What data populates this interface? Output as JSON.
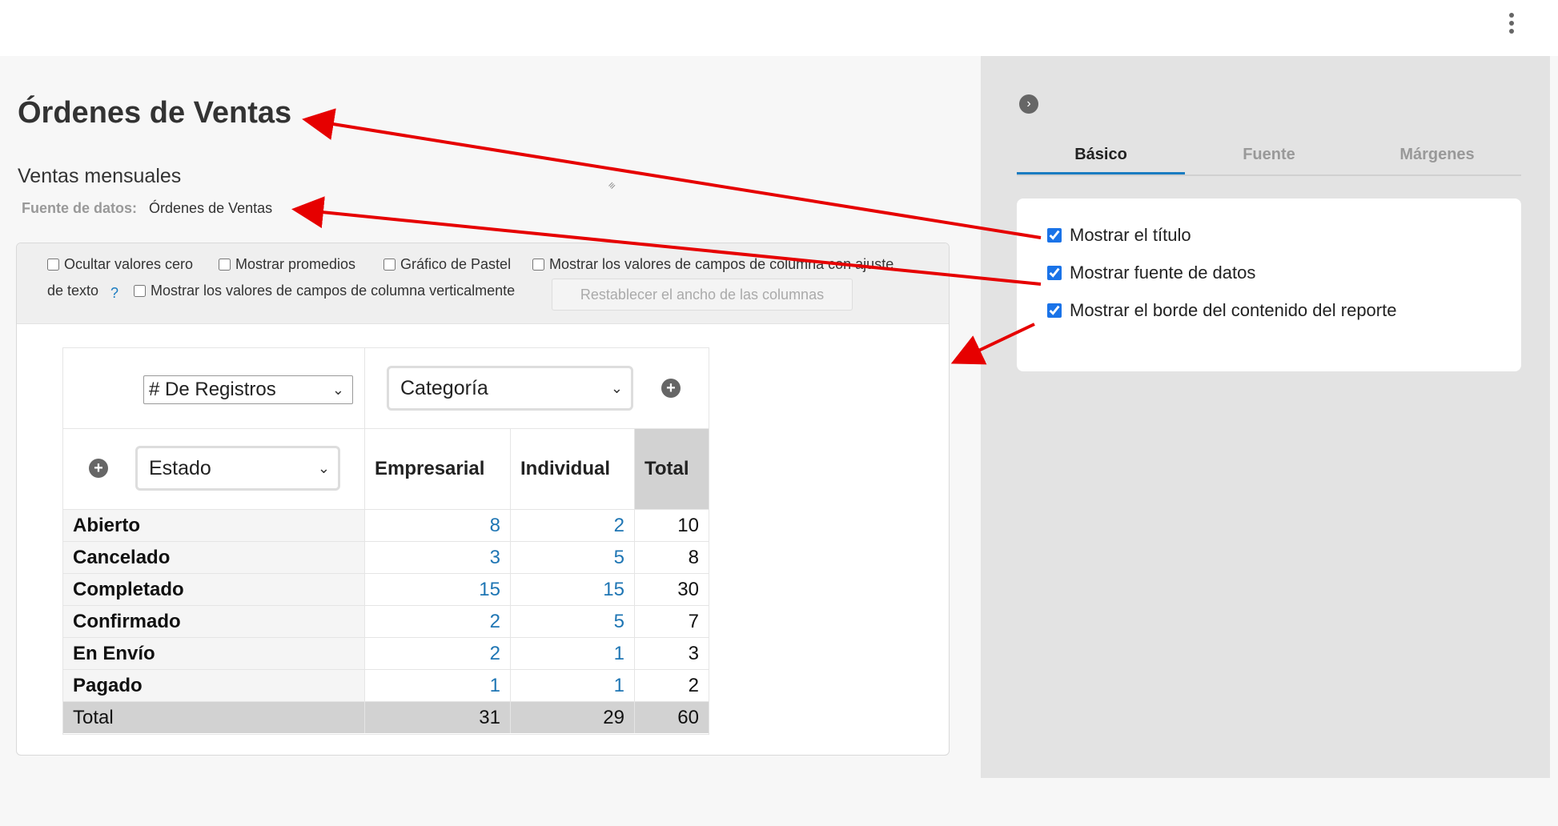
{
  "page": {
    "title": "Órdenes de Ventas",
    "subtitle": "Ventas mensuales",
    "data_source_label": "Fuente de datos:",
    "data_source_value": "Órdenes de Ventas"
  },
  "options": {
    "hide_zero": "Ocultar valores cero",
    "show_avg": "Mostrar promedios",
    "pie_chart": "Gráfico de Pastel",
    "wrap_text_line1": "Mostrar los valores de campos de columna con ajuste",
    "wrap_text_line2": "de texto",
    "help": "?",
    "vertical": "Mostrar los valores de campos de columna verticalmente",
    "reset_width": "Restablecer el ancho de las columnas"
  },
  "pivot": {
    "measure_select": "# De Registros",
    "column_field_select": "Categoría",
    "row_field_select": "Estado",
    "columns": [
      "Empresarial",
      "Individual",
      "Total"
    ],
    "rows": [
      {
        "label": "Abierto",
        "values": [
          "8",
          "2",
          "10"
        ]
      },
      {
        "label": "Cancelado",
        "values": [
          "3",
          "5",
          "8"
        ]
      },
      {
        "label": "Completado",
        "values": [
          "15",
          "15",
          "30"
        ]
      },
      {
        "label": "Confirmado",
        "values": [
          "2",
          "5",
          "7"
        ]
      },
      {
        "label": "En Envío",
        "values": [
          "2",
          "1",
          "3"
        ]
      },
      {
        "label": "Pagado",
        "values": [
          "1",
          "1",
          "2"
        ]
      }
    ],
    "total_row": {
      "label": "Total",
      "values": [
        "31",
        "29",
        "60"
      ]
    }
  },
  "panel": {
    "tabs": [
      "Básico",
      "Fuente",
      "Márgenes"
    ],
    "active_tab": "Básico",
    "checkboxes": [
      {
        "label": "Mostrar el título",
        "checked": true
      },
      {
        "label": "Mostrar fuente de datos",
        "checked": true
      },
      {
        "label": "Mostrar el borde del contenido del reporte",
        "checked": true
      }
    ]
  },
  "colors": {
    "accent": "#1a73e8",
    "link_number": "#1f76b4",
    "annotation_arrow": "#e60000"
  },
  "icons": [
    "more-vertical-icon",
    "chevron-right-icon",
    "plus-icon",
    "chevron-down-icon",
    "resize-grip-icon"
  ]
}
